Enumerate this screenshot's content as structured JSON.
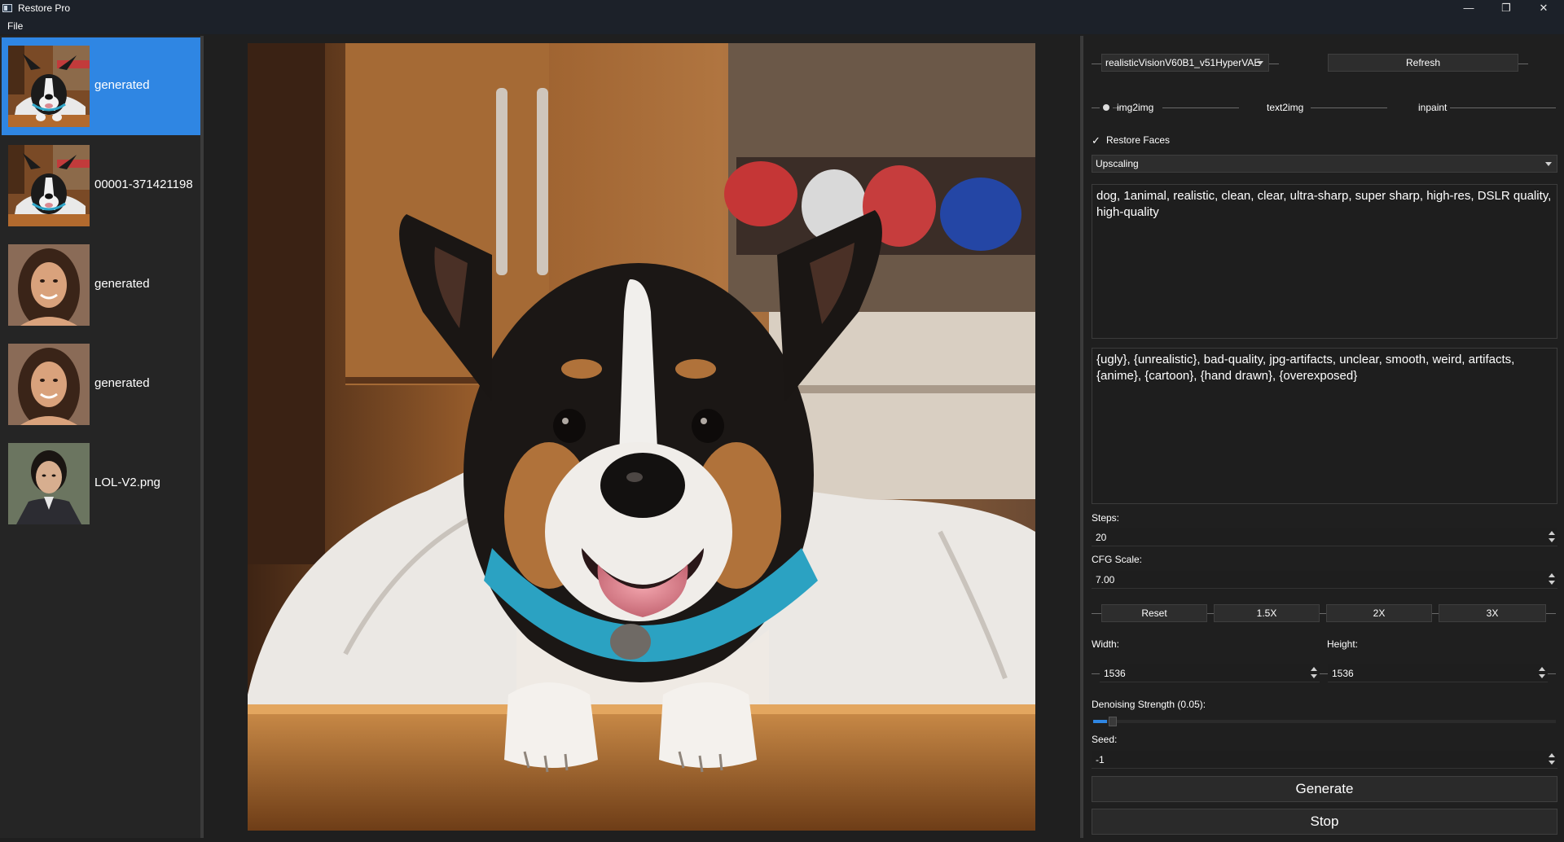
{
  "window": {
    "title": "Restore Pro",
    "minimize_glyph": "—",
    "maximize_glyph": "❐",
    "close_glyph": "✕"
  },
  "menu": {
    "file": "File"
  },
  "history": [
    {
      "label": "generated",
      "selected": true,
      "icon": "dog-thumbnail"
    },
    {
      "label": "00001-371421198",
      "selected": false,
      "icon": "dog-thumbnail"
    },
    {
      "label": "generated",
      "selected": false,
      "icon": "woman-portrait-thumbnail"
    },
    {
      "label": "generated",
      "selected": false,
      "icon": "woman-portrait-thumbnail"
    },
    {
      "label": "LOL-V2.png",
      "selected": false,
      "icon": "asian-woman-portrait-thumbnail"
    }
  ],
  "controls": {
    "model": "realisticVisionV60B1_v51HyperVAE",
    "refresh": "Refresh",
    "modes": [
      "img2img",
      "text2img",
      "inpaint"
    ],
    "selected_mode": "img2img",
    "restore_faces_label": "Restore Faces",
    "restore_faces_checked": true,
    "check_glyph": "✓",
    "upscaling": "Upscaling",
    "prompt": "dog, 1animal, realistic, clean, clear, ultra-sharp, super sharp, high-res, DSLR quality, high-quality",
    "negative_prompt": "{ugly}, {unrealistic}, bad-quality, jpg-artifacts, unclear, smooth, weird, artifacts, {anime}, {cartoon}, {hand drawn}, {overexposed}",
    "steps_label": "Steps:",
    "steps": "20",
    "cfg_label": "CFG Scale:",
    "cfg": "7.00",
    "scale_buttons": [
      "Reset",
      "1.5X",
      "2X",
      "3X"
    ],
    "width_label": "Width:",
    "width": "1536",
    "height_label": "Height:",
    "height": "1536",
    "denoise_label": "Denoising Strength (0.05):",
    "denoise_value": 0.05,
    "seed_label": "Seed:",
    "seed": "-1",
    "generate": "Generate",
    "stop": "Stop"
  },
  "colors": {
    "selection": "#2f86e3",
    "slider_fill": "#2f86e3",
    "background": "#1f1f1f",
    "titlebar": "#1c2129"
  }
}
